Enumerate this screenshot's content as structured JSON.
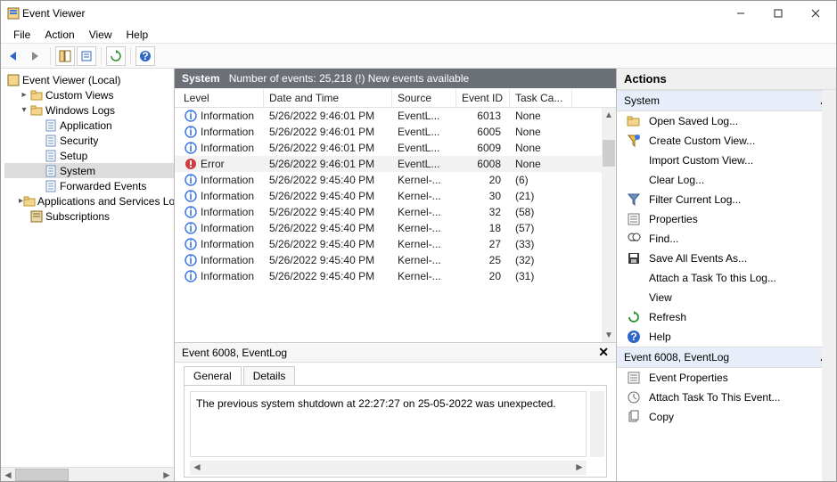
{
  "titlebar": {
    "app_icon": "event-viewer-icon",
    "title": "Event Viewer"
  },
  "menubar": [
    "File",
    "Action",
    "View",
    "Help"
  ],
  "toolbar": [
    {
      "name": "nav-back-icon"
    },
    {
      "name": "nav-forward-icon"
    },
    {
      "type": "sep"
    },
    {
      "name": "show-tree-icon",
      "box": true
    },
    {
      "name": "properties-icon",
      "box": true
    },
    {
      "type": "sep"
    },
    {
      "name": "refresh-icon",
      "box": true
    },
    {
      "type": "sep"
    },
    {
      "name": "help-icon",
      "box": true
    }
  ],
  "tree": {
    "root": {
      "label": "Event Viewer (Local)",
      "icon": "ev-app"
    },
    "l1": [
      {
        "label": "Custom Views",
        "icon": "folder",
        "tw": ">",
        "indent": 1
      },
      {
        "label": "Windows Logs",
        "icon": "folder",
        "tw": "v",
        "indent": 1
      },
      {
        "label": "Application",
        "icon": "log",
        "indent": 2,
        "parent": 1
      },
      {
        "label": "Security",
        "icon": "log",
        "indent": 2,
        "parent": 1
      },
      {
        "label": "Setup",
        "icon": "log",
        "indent": 2,
        "parent": 1
      },
      {
        "label": "System",
        "icon": "log",
        "indent": 2,
        "parent": 1,
        "selected": true
      },
      {
        "label": "Forwarded Events",
        "icon": "log",
        "indent": 2,
        "parent": 1
      },
      {
        "label": "Applications and Services Lo",
        "icon": "folder",
        "tw": ">",
        "indent": 1
      },
      {
        "label": "Subscriptions",
        "icon": "subs",
        "indent": 1
      }
    ]
  },
  "center": {
    "title": "System",
    "count_text": "Number of events: 25,218 (!) New events available",
    "columns": [
      "Level",
      "Date and Time",
      "Source",
      "Event ID",
      "Task Ca..."
    ],
    "rows": [
      {
        "level": "Information",
        "dt": "5/26/2022 9:46:01 PM",
        "src": "EventL...",
        "eid": "6013",
        "task": "None"
      },
      {
        "level": "Information",
        "dt": "5/26/2022 9:46:01 PM",
        "src": "EventL...",
        "eid": "6005",
        "task": "None"
      },
      {
        "level": "Information",
        "dt": "5/26/2022 9:46:01 PM",
        "src": "EventL...",
        "eid": "6009",
        "task": "None"
      },
      {
        "level": "Error",
        "dt": "5/26/2022 9:46:01 PM",
        "src": "EventL...",
        "eid": "6008",
        "task": "None",
        "selected": true
      },
      {
        "level": "Information",
        "dt": "5/26/2022 9:45:40 PM",
        "src": "Kernel-...",
        "eid": "20",
        "task": "(6)"
      },
      {
        "level": "Information",
        "dt": "5/26/2022 9:45:40 PM",
        "src": "Kernel-...",
        "eid": "30",
        "task": "(21)"
      },
      {
        "level": "Information",
        "dt": "5/26/2022 9:45:40 PM",
        "src": "Kernel-...",
        "eid": "32",
        "task": "(58)"
      },
      {
        "level": "Information",
        "dt": "5/26/2022 9:45:40 PM",
        "src": "Kernel-...",
        "eid": "18",
        "task": "(57)"
      },
      {
        "level": "Information",
        "dt": "5/26/2022 9:45:40 PM",
        "src": "Kernel-...",
        "eid": "27",
        "task": "(33)"
      },
      {
        "level": "Information",
        "dt": "5/26/2022 9:45:40 PM",
        "src": "Kernel-...",
        "eid": "25",
        "task": "(32)"
      },
      {
        "level": "Information",
        "dt": "5/26/2022 9:45:40 PM",
        "src": "Kernel-...",
        "eid": "20",
        "task": "(31)"
      }
    ],
    "detail": {
      "header": "Event 6008, EventLog",
      "tab_general": "General",
      "tab_details": "Details",
      "message": "The previous system shutdown at 22:27:27 on 25-05-2022 was unexpected."
    }
  },
  "actions": {
    "title": "Actions",
    "group1": "System",
    "group1_items": [
      {
        "icon": "folder-open",
        "label": "Open Saved Log..."
      },
      {
        "icon": "funnel-new",
        "label": "Create Custom View..."
      },
      {
        "icon": "blank",
        "label": "Import Custom View..."
      },
      {
        "icon": "blank",
        "label": "Clear Log..."
      },
      {
        "icon": "funnel",
        "label": "Filter Current Log..."
      },
      {
        "icon": "props",
        "label": "Properties"
      },
      {
        "icon": "find",
        "label": "Find..."
      },
      {
        "icon": "save",
        "label": "Save All Events As..."
      },
      {
        "icon": "blank",
        "label": "Attach a Task To this Log..."
      },
      {
        "icon": "blank",
        "label": "View",
        "sub": true
      },
      {
        "icon": "refresh",
        "label": "Refresh"
      },
      {
        "icon": "help",
        "label": "Help",
        "sub": true
      }
    ],
    "group2": "Event 6008, EventLog",
    "group2_items": [
      {
        "icon": "props",
        "label": "Event Properties"
      },
      {
        "icon": "task",
        "label": "Attach Task To This Event..."
      },
      {
        "icon": "copy",
        "label": "Copy",
        "sub": true
      }
    ]
  }
}
